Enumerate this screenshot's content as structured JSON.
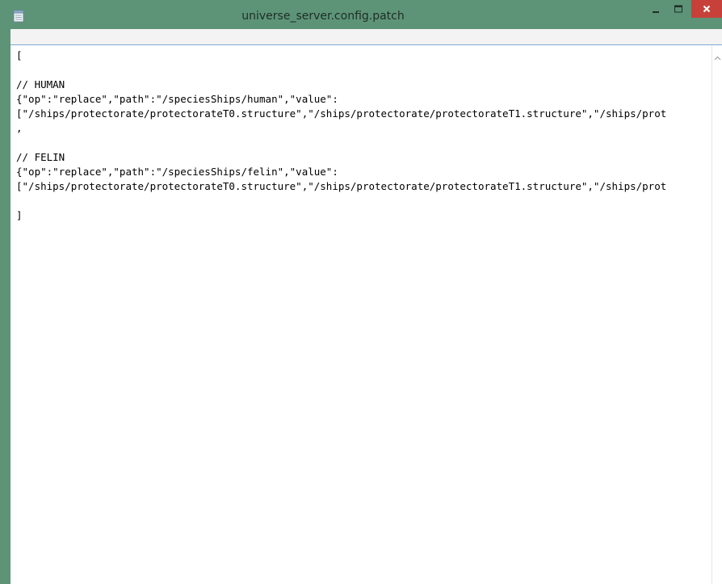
{
  "window": {
    "title": "universe_server.config.patch"
  },
  "icons": {
    "app": "notepad-icon",
    "minimize": "minimize-icon",
    "maximize": "maximize-icon",
    "close": "close-icon",
    "scroll_up": "scroll-up-arrow-icon"
  },
  "colors": {
    "titlebar": "#5d9478",
    "close_button": "#c7413a",
    "editor_background": "#ffffff",
    "text": "#000000"
  },
  "editor": {
    "content": "[\n\n// HUMAN\n{\"op\":\"replace\",\"path\":\"/speciesShips/human\",\"value\":\n[\"/ships/protectorate/protectorateT0.structure\",\"/ships/protectorate/protectorateT1.structure\",\"/ships/prot\n,\n\n// FELIN\n{\"op\":\"replace\",\"path\":\"/speciesShips/felin\",\"value\":\n[\"/ships/protectorate/protectorateT0.structure\",\"/ships/protectorate/protectorateT1.structure\",\"/ships/prot\n\n]"
  }
}
